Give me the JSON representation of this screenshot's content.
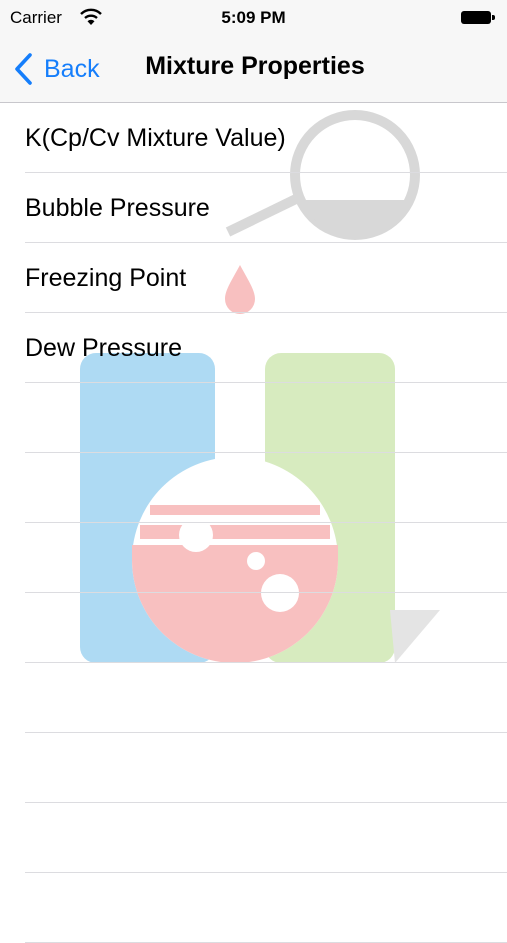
{
  "status_bar": {
    "carrier": "Carrier",
    "time": "5:09 PM"
  },
  "nav": {
    "back_label": "Back",
    "title": "Mixture Properties"
  },
  "rows": [
    {
      "label": "K(Cp/Cv Mixture Value)"
    },
    {
      "label": "Bubble Pressure"
    },
    {
      "label": "Freezing Point"
    },
    {
      "label": "Dew Pressure"
    }
  ],
  "colors": {
    "accent": "#157efb",
    "separator": "#dcdce0",
    "bar_background": "#f7f7f7"
  }
}
